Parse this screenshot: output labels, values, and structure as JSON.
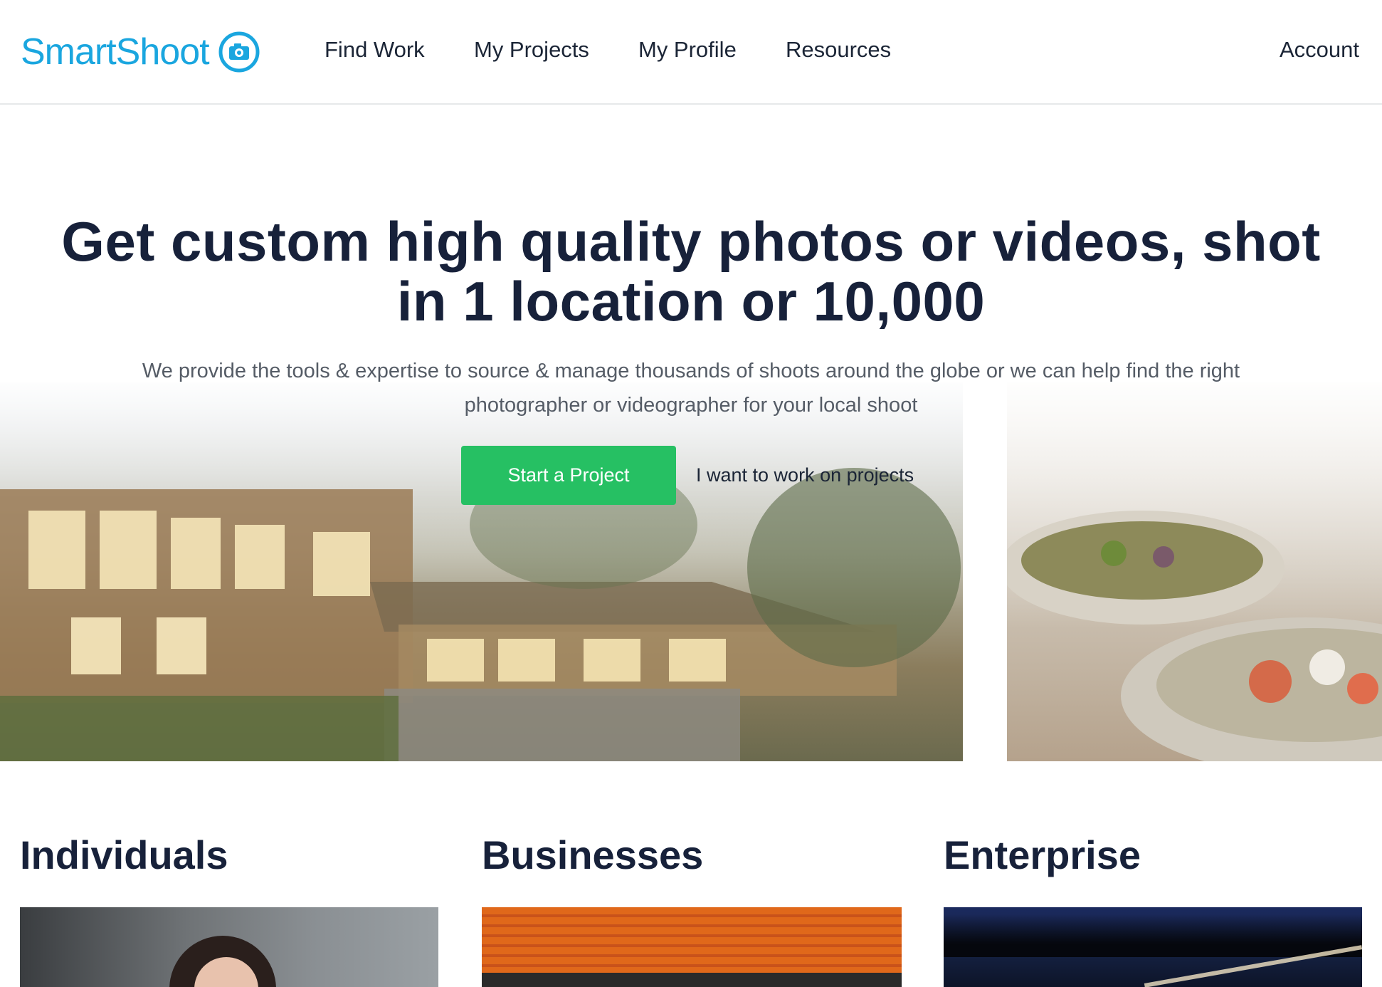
{
  "header": {
    "logo_text": "SmartShoot",
    "brand_color": "#1aa6df",
    "nav": [
      {
        "label": "Find Work"
      },
      {
        "label": "My Projects"
      },
      {
        "label": "My Profile"
      },
      {
        "label": "Resources"
      }
    ],
    "account_label": "Account"
  },
  "hero": {
    "title": "Get custom high quality photos or videos, shot in 1 location or 10,000",
    "subtitle": "We provide the tools & expertise to source & manage thousands of shoots around the globe or we can help find the right photographer or videographer for your local shoot",
    "primary_cta": "Start a Project",
    "primary_cta_color": "#26c063",
    "secondary_cta": "I want to work on projects"
  },
  "segments": [
    {
      "title": "Individuals"
    },
    {
      "title": "Businesses"
    },
    {
      "title": "Enterprise"
    }
  ]
}
